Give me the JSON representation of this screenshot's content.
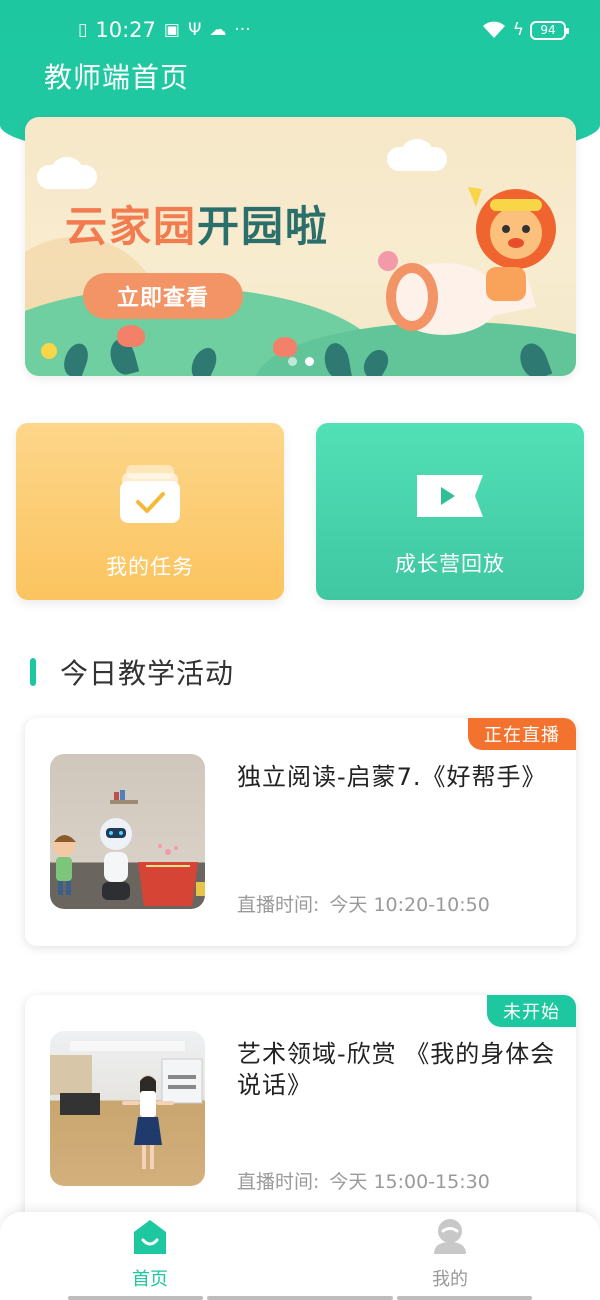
{
  "status_bar": {
    "time": "10:27",
    "battery": "94",
    "colors": {
      "text": "#ffffff"
    }
  },
  "header": {
    "title": "教师端首页",
    "bg_color": "#1dc79f"
  },
  "banner": {
    "title_part1": "云家园",
    "title_part2": "开园啦",
    "button_label": "立即查看",
    "active_dot": 1,
    "dot_count": 2
  },
  "quick_cards": [
    {
      "label": "我的任务",
      "icon": "task-check-icon"
    },
    {
      "label": "成长营回放",
      "icon": "video-play-icon"
    }
  ],
  "section": {
    "title": "今日教学活动"
  },
  "activities": [
    {
      "status": "正在直播",
      "status_color": "#f2722e",
      "title": "独立阅读-启蒙7.《好帮手》",
      "time_label": "直播时间:",
      "time_value": "今天 10:20-10:50"
    },
    {
      "status": "未开始",
      "status_color": "#1dc79f",
      "title": "艺术领域-欣赏 《我的身体会说话》",
      "time_label": "直播时间:",
      "time_value": "今天 15:00-15:30"
    }
  ],
  "bottom_nav": {
    "items": [
      {
        "label": "首页",
        "icon": "home-icon",
        "active": true
      },
      {
        "label": "我的",
        "icon": "user-icon",
        "active": false
      }
    ],
    "active_color": "#1dc79f",
    "inactive_color": "#999999"
  }
}
